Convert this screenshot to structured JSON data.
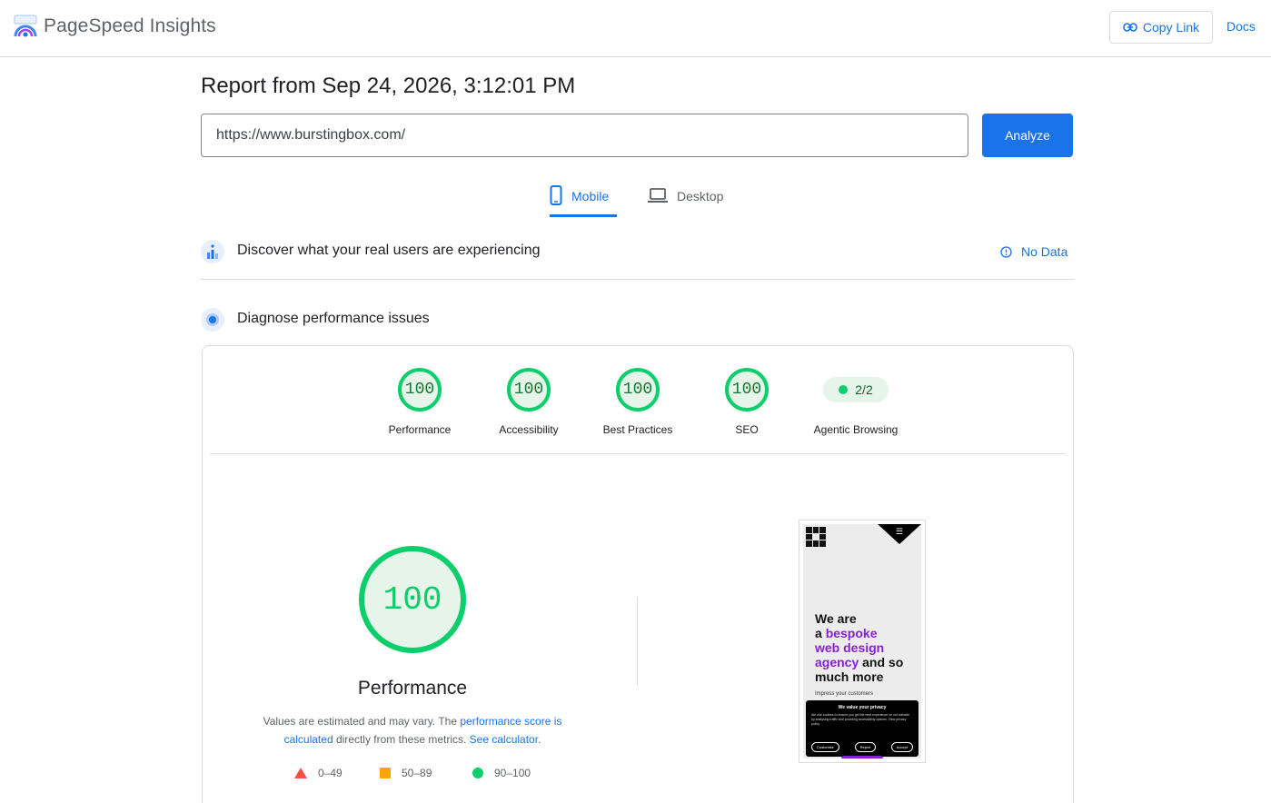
{
  "header": {
    "brand": "PageSpeed Insights",
    "copy_link_label": "Copy Link",
    "docs_label": "Docs"
  },
  "report": {
    "title": "Report from Sep 24, 2026, 3:12:01 PM",
    "url_value": "https://www.burstingbox.com/",
    "analyze_label": "Analyze"
  },
  "tabs": {
    "mobile": "Mobile",
    "desktop": "Desktop",
    "selected": "Mobile"
  },
  "crux": {
    "title": "Discover what your real users are experiencing",
    "status": "No Data"
  },
  "diagnose": {
    "title": "Diagnose performance issues"
  },
  "categories": [
    {
      "label": "Performance",
      "score": "100"
    },
    {
      "label": "Accessibility",
      "score": "100"
    },
    {
      "label": "Best Practices",
      "score": "100"
    },
    {
      "label": "SEO",
      "score": "100"
    },
    {
      "label": "Agentic Browsing",
      "score": "2/2"
    }
  ],
  "performance": {
    "score": "100",
    "title": "Performance",
    "note_prefix": "Values are estimated and may vary. The ",
    "note_link1": "performance score is calculated",
    "note_middle": " directly from these metrics. ",
    "note_link2": "See calculator",
    "note_suffix": "."
  },
  "legend": [
    {
      "range": "0–49",
      "color": "#ff4e42",
      "shape": "triangle"
    },
    {
      "range": "50–89",
      "color": "#ffa400",
      "shape": "square"
    },
    {
      "range": "90–100",
      "color": "#0cce6b",
      "shape": "circle"
    }
  ],
  "screenshot": {
    "hero_line1": "We are",
    "hero_line2_a": "a ",
    "hero_line2_b": "bespoke",
    "hero_line3": "web design",
    "hero_line4_a": "agency",
    "hero_line4_b": " and so",
    "hero_line5": "much more",
    "impress": "Impress your customers",
    "cookie_title": "We value your privacy",
    "cookie_body": "We use cookies to ensure you get the best experience on our website by analysing traffic and providing accessibility options. View privacy policy",
    "btn_customise": "Customise",
    "btn_reject": "Reject",
    "btn_accept": "Accept"
  },
  "colors": {
    "accent": "#1a73e8",
    "pass": "#0cce6b",
    "pass_text": "#0a7a2f",
    "brand_purple": "#8a1dd7"
  }
}
